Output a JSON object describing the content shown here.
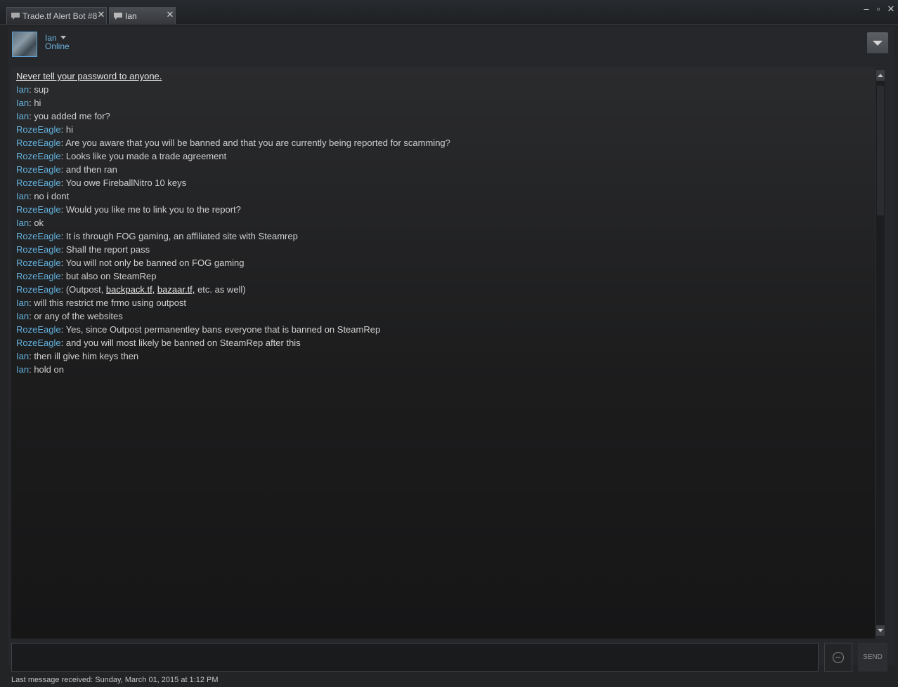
{
  "tabs": [
    {
      "label": "Trade.tf Alert Bot #8",
      "icon": "chat-bubble-icon",
      "active": false
    },
    {
      "label": "Ian",
      "icon": "chat-bubble-icon",
      "active": true
    }
  ],
  "window": {
    "minimize": "–",
    "restore": "▫",
    "close": "✕"
  },
  "header": {
    "username": "Ian",
    "status": "Online"
  },
  "chat": {
    "warning": "Never tell your password to anyone.",
    "messages": [
      {
        "sender": "Ian",
        "text": "sup"
      },
      {
        "sender": "Ian",
        "text": "hi"
      },
      {
        "sender": "Ian",
        "text": "you added me for?"
      },
      {
        "sender": "RozeEagle",
        "text": "hi"
      },
      {
        "sender": "RozeEagle",
        "text": "Are you aware that you will be banned and that you are currently being reported for scamming?"
      },
      {
        "sender": "RozeEagle",
        "text": "Looks like you made a trade agreement"
      },
      {
        "sender": "RozeEagle",
        "text": "and then ran"
      },
      {
        "sender": "RozeEagle",
        "text": "You owe FireballNitro 10 keys"
      },
      {
        "sender": "Ian",
        "text": "no i dont"
      },
      {
        "sender": "RozeEagle",
        "text": "Would you like me to link you to the report?"
      },
      {
        "sender": "Ian",
        "text": "ok"
      },
      {
        "sender": "RozeEagle",
        "text": "It is through FOG gaming, an affiliated site with Steamrep"
      },
      {
        "sender": "RozeEagle",
        "text": "Shall the report pass"
      },
      {
        "sender": "RozeEagle",
        "text": "You will not only be banned on FOG gaming"
      },
      {
        "sender": "RozeEagle",
        "text": "but also on SteamRep"
      },
      {
        "sender": "RozeEagle",
        "text": "",
        "parts": {
          "pre": "(Outpost, ",
          "link1": "backpack.tf,",
          "mid": " ",
          "link2": "bazaar.tf,",
          "post": " etc. as well)"
        }
      },
      {
        "sender": "Ian",
        "text": "will this restrict me frmo using outpost"
      },
      {
        "sender": "Ian",
        "text": "or any of the websites"
      },
      {
        "sender": "RozeEagle",
        "text": "Yes, since Outpost permanentley bans everyone that is banned on SteamRep"
      },
      {
        "sender": "RozeEagle",
        "text": "and you will most likely be banned on SteamRep after this"
      },
      {
        "sender": "Ian",
        "text": "then ill give him keys then"
      },
      {
        "sender": "Ian",
        "text": "hold on"
      }
    ]
  },
  "input": {
    "placeholder": "",
    "value": ""
  },
  "send_label": "SEND",
  "footer": "Last message received: Sunday, March 01, 2015 at 1:12 PM",
  "colors": {
    "sender": "#62b1dd",
    "text": "#d0d0d0",
    "background": "#232426"
  }
}
